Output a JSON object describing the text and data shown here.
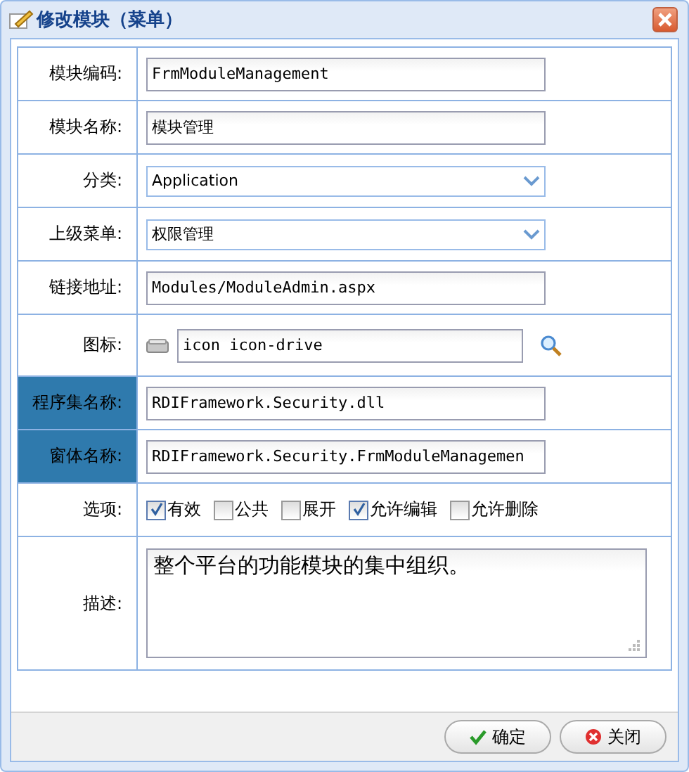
{
  "window": {
    "title": "修改模块（菜单）"
  },
  "rows": [
    {
      "label": "模块编码:",
      "kind": "text",
      "highlighted": false,
      "value": "FrmModuleManagement"
    },
    {
      "label": "模块名称:",
      "kind": "text",
      "highlighted": false,
      "value": "模块管理"
    },
    {
      "label": "分类:",
      "kind": "select",
      "highlighted": false,
      "value": "Application"
    },
    {
      "label": "上级菜单:",
      "kind": "select",
      "highlighted": false,
      "value": "权限管理"
    },
    {
      "label": "链接地址:",
      "kind": "text",
      "highlighted": false,
      "value": "Modules/ModuleAdmin.aspx"
    },
    {
      "label": "图标:",
      "kind": "icon",
      "highlighted": false,
      "value": "icon icon-drive"
    },
    {
      "label": "程序集名称:",
      "kind": "text",
      "highlighted": true,
      "value": "RDIFramework.Security.dll"
    },
    {
      "label": "窗体名称:",
      "kind": "text",
      "highlighted": true,
      "value": "RDIFramework.Security.FrmModuleManagemen"
    },
    {
      "label": "选项:",
      "kind": "options",
      "highlighted": false,
      "options": [
        {
          "label": "有效",
          "checked": true
        },
        {
          "label": "公共",
          "checked": false
        },
        {
          "label": "展开",
          "checked": false
        },
        {
          "label": "允许编辑",
          "checked": true
        },
        {
          "label": "允许删除",
          "checked": false
        }
      ]
    },
    {
      "label": "描述:",
      "kind": "textarea",
      "highlighted": false,
      "value": "整个平台的功能模块的集中组织。"
    }
  ],
  "buttons": [
    {
      "label": "确定",
      "kind": "ok"
    },
    {
      "label": "关闭",
      "kind": "close"
    }
  ]
}
